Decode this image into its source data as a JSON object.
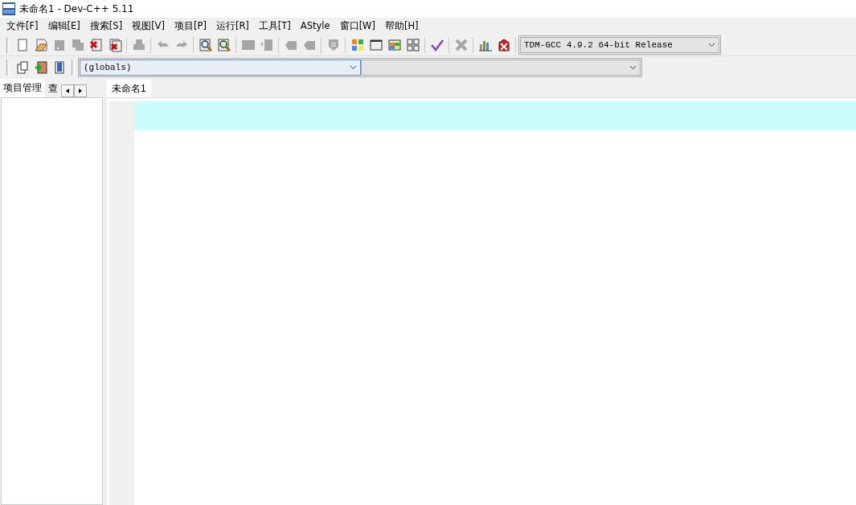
{
  "window": {
    "title": "未命名1 - Dev-C++ 5.11"
  },
  "menu": [
    "文件[F]",
    "编辑[E]",
    "搜索[S]",
    "视图[V]",
    "项目[P]",
    "运行[R]",
    "工具[T]",
    "AStyle",
    "窗口[W]",
    "帮助[H]"
  ],
  "toolbar": [
    {
      "kind": "new",
      "disabled": false
    },
    {
      "kind": "open",
      "disabled": false
    },
    {
      "kind": "save",
      "disabled": true
    },
    {
      "kind": "saveall",
      "disabled": true
    },
    {
      "kind": "close",
      "disabled": false
    },
    {
      "kind": "closeall",
      "disabled": false
    },
    {
      "kind": "sep"
    },
    {
      "kind": "print",
      "disabled": true
    },
    {
      "kind": "sep"
    },
    {
      "kind": "undo",
      "disabled": true
    },
    {
      "kind": "redo",
      "disabled": true
    },
    {
      "kind": "sep"
    },
    {
      "kind": "find",
      "disabled": false
    },
    {
      "kind": "replace",
      "disabled": false
    },
    {
      "kind": "sep"
    },
    {
      "kind": "indent",
      "disabled": true
    },
    {
      "kind": "unindent",
      "disabled": true
    },
    {
      "kind": "sep"
    },
    {
      "kind": "bookmark",
      "disabled": true
    },
    {
      "kind": "goto",
      "disabled": true
    },
    {
      "kind": "sep"
    },
    {
      "kind": "shield",
      "disabled": true
    },
    {
      "kind": "sep"
    },
    {
      "kind": "tiles",
      "disabled": false
    },
    {
      "kind": "window",
      "disabled": false
    },
    {
      "kind": "colorwin",
      "disabled": false
    },
    {
      "kind": "grid",
      "disabled": false
    },
    {
      "kind": "sep"
    },
    {
      "kind": "check",
      "disabled": false
    },
    {
      "kind": "sep"
    },
    {
      "kind": "cross",
      "disabled": true
    },
    {
      "kind": "sep"
    },
    {
      "kind": "chart",
      "disabled": false
    },
    {
      "kind": "stop",
      "disabled": false
    },
    {
      "kind": "sep"
    }
  ],
  "compiler": {
    "value": "TDM-GCC 4.9.2 64-bit Release"
  },
  "toolbar2": [
    {
      "kind": "newclass",
      "disabled": false
    },
    {
      "kind": "addfile",
      "disabled": false
    },
    {
      "kind": "book",
      "disabled": false
    }
  ],
  "scope_select": {
    "value": "(globals)"
  },
  "left_tabs": [
    {
      "label": "项目管理",
      "selected": true
    },
    {
      "label": "查",
      "selected": false
    }
  ],
  "editor_tabs": [
    {
      "label": "未命名1",
      "selected": true
    }
  ]
}
